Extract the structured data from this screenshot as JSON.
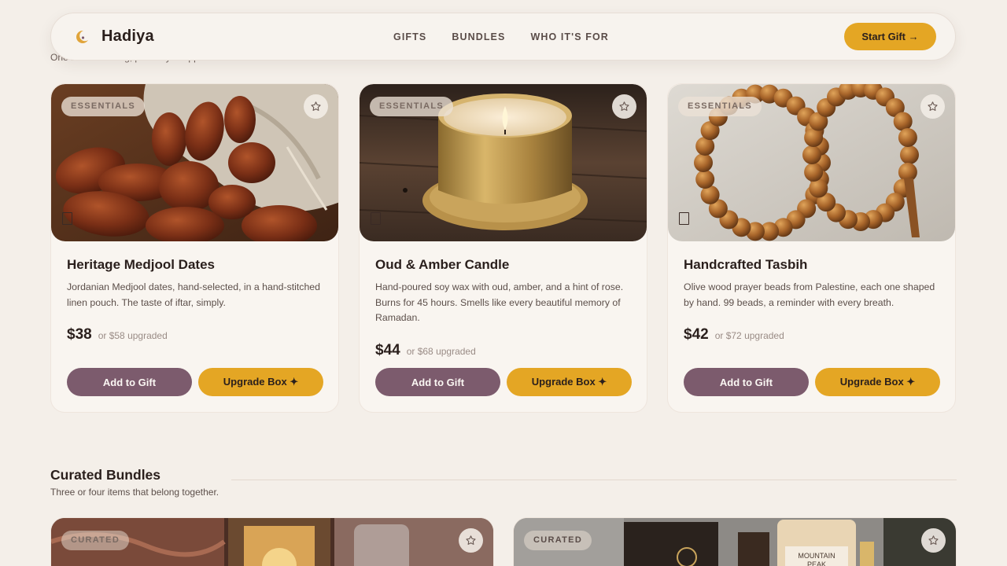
{
  "header": {
    "brand": "Hadiya",
    "nav": [
      "GIFTS",
      "BUNDLES",
      "WHO IT'S FOR"
    ],
    "cta": "Start Gift →",
    "behind_tagline": "One beautiful thing, perfectly wrapped."
  },
  "products": [
    {
      "badge": "ESSENTIALS",
      "title": "Heritage Medjool Dates",
      "desc": "Jordanian Medjool dates, hand-selected, in a hand-stitched linen pouch. The taste of iftar, simply.",
      "price": "$38",
      "price_alt": "or $58 upgraded",
      "add_label": "Add to Gift",
      "upgrade_label": "Upgrade Box ✦"
    },
    {
      "badge": "ESSENTIALS",
      "title": "Oud & Amber Candle",
      "desc": "Hand-poured soy wax with oud, amber, and a hint of rose. Burns for 45 hours. Smells like every beautiful memory of Ramadan.",
      "price": "$44",
      "price_alt": "or $68 upgraded",
      "add_label": "Add to Gift",
      "upgrade_label": "Upgrade Box ✦"
    },
    {
      "badge": "ESSENTIALS",
      "title": "Handcrafted Tasbih",
      "desc": "Olive wood prayer beads from Palestine, each one shaped by hand. 99 beads, a reminder with every breath.",
      "price": "$42",
      "price_alt": "or $72 upgraded",
      "add_label": "Add to Gift",
      "upgrade_label": "Upgrade Box ✦"
    }
  ],
  "bundles_section": {
    "title": "Curated Bundles",
    "subtitle": "Three or four items that belong together.",
    "cards": [
      {
        "badge": "CURATED"
      },
      {
        "badge": "CURATED"
      }
    ]
  },
  "colors": {
    "background": "#f4efe9",
    "accent_gold": "#e4a624",
    "accent_plum": "#7c5b6d"
  }
}
